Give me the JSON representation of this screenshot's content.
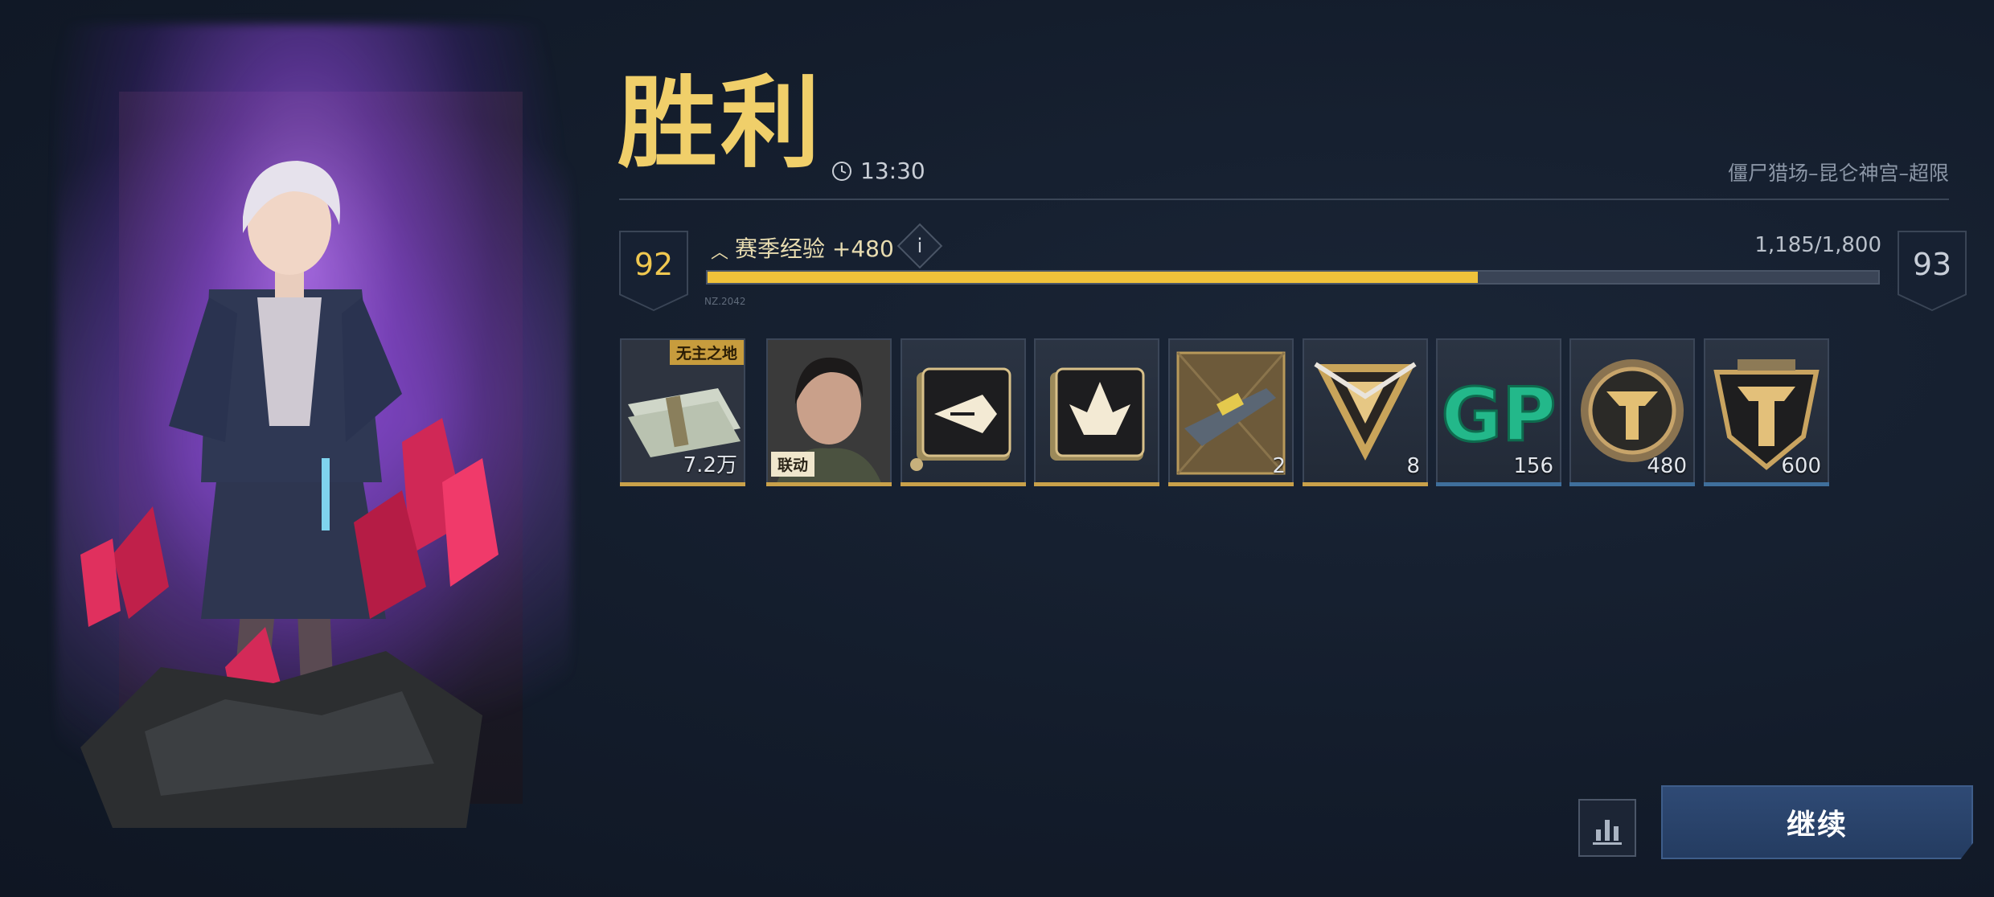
{
  "header": {
    "title": "胜利",
    "time": "13:30",
    "mode": "僵尸猎场–昆仑神宫–超限"
  },
  "progress": {
    "current_level": "92",
    "next_level": "93",
    "xp_label": "赛季经验 +480",
    "info_label": "i",
    "xp_count": "1,185/1,800",
    "fraction": 0.658,
    "code": "NZ.2042"
  },
  "rewards": [
    {
      "name": "cash-stack",
      "quantity": "7.2万",
      "tag": "无主之地"
    },
    {
      "name": "character-portrait",
      "quantity": "",
      "tag": "联动"
    },
    {
      "name": "arrow-emblem",
      "quantity": ""
    },
    {
      "name": "flame-emblem",
      "quantity": ""
    },
    {
      "name": "rifle-crate",
      "quantity": "2"
    },
    {
      "name": "triangle-crystal",
      "quantity": "8"
    },
    {
      "name": "gp-points",
      "quantity": "156",
      "label": "GP"
    },
    {
      "name": "bronze-medal",
      "quantity": "480"
    },
    {
      "name": "shield-emblem",
      "quantity": "600"
    }
  ],
  "actions": {
    "continue_label": "继续"
  },
  "colors": {
    "accent_gold": "#f0c23a",
    "title_gold": "#f0cf6a",
    "button_blue": "#2f4a75"
  }
}
